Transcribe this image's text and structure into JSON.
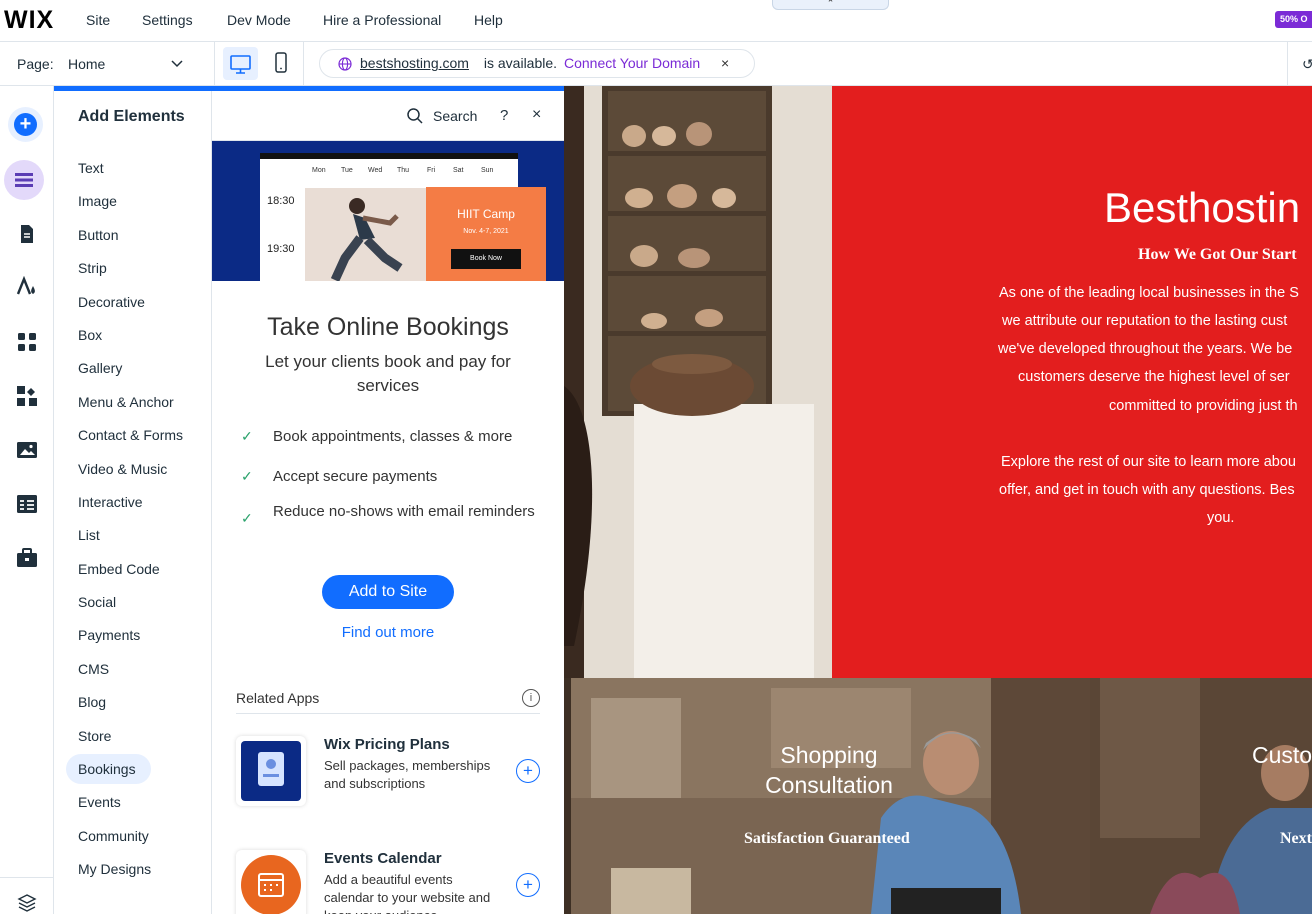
{
  "topbar": {
    "logo": "WIX",
    "menu": [
      "Site",
      "Settings",
      "Dev Mode",
      "Hire a Professional",
      "Help"
    ],
    "promo": "50% O"
  },
  "pagebar": {
    "page_label": "Page:",
    "page_value": "Home",
    "domain": "bestshosting.com",
    "domain_status": " is available. ",
    "connect_label": "Connect Your Domain",
    "close": "×"
  },
  "panel": {
    "title": "Add Elements",
    "search": "Search",
    "help": "?",
    "close": "×",
    "categories": [
      "Text",
      "Image",
      "Button",
      "Strip",
      "Decorative",
      "Box",
      "Gallery",
      "Menu & Anchor",
      "Contact & Forms",
      "Video & Music",
      "Interactive",
      "List",
      "Embed Code",
      "Social",
      "Payments",
      "CMS",
      "Blog",
      "Store",
      "Bookings",
      "Events",
      "Community",
      "My Designs"
    ],
    "selected_category": "Bookings"
  },
  "detail": {
    "preview": {
      "days": [
        "Mon",
        "Tue",
        "Wed",
        "Thu",
        "Fri",
        "Sat",
        "Sun"
      ],
      "times": [
        "18:30",
        "19:30"
      ],
      "event_title": "HIIT Camp",
      "event_date": "Nov. 4-7, 2021",
      "book_button": "Book Now"
    },
    "title": "Take Online Bookings",
    "subtitle": "Let your clients book and pay for services",
    "features": [
      "Book appointments, classes & more",
      "Accept secure payments",
      "Reduce no-shows with email reminders"
    ],
    "add_button": "Add to Site",
    "find_more": "Find out more",
    "related_label": "Related Apps",
    "apps": [
      {
        "title": "Wix Pricing Plans",
        "desc": "Sell packages, memberships and subscriptions",
        "icon": "pricing-plans-icon"
      },
      {
        "title": "Events Calendar",
        "desc": "Add a beautiful events calendar to your website and keep your audience",
        "icon": "events-calendar-icon"
      }
    ]
  },
  "canvas": {
    "site_title": "Besthostin",
    "site_subtitle": "How We Got Our Start",
    "paragraph_lines": [
      "As one of the leading local businesses in the S",
      "we attribute our reputation to the lasting cust",
      "we've developed throughout the years. We be",
      "customers deserve the highest level of ser",
      "committed to providing just th"
    ],
    "paragraph2_lines": [
      "Explore the rest of our site to learn more abou",
      "offer, and get in touch with any questions. Bes",
      "you."
    ],
    "card1_title": "Shopping Consultation",
    "card1_sub": "Satisfaction Guaranteed",
    "card2_title": "Custo",
    "card2_sub": "Next"
  },
  "colors": {
    "accent": "#116dff",
    "red_section": "#e31e1e",
    "promo": "#7b2bd6",
    "orange": "#f47c45"
  }
}
